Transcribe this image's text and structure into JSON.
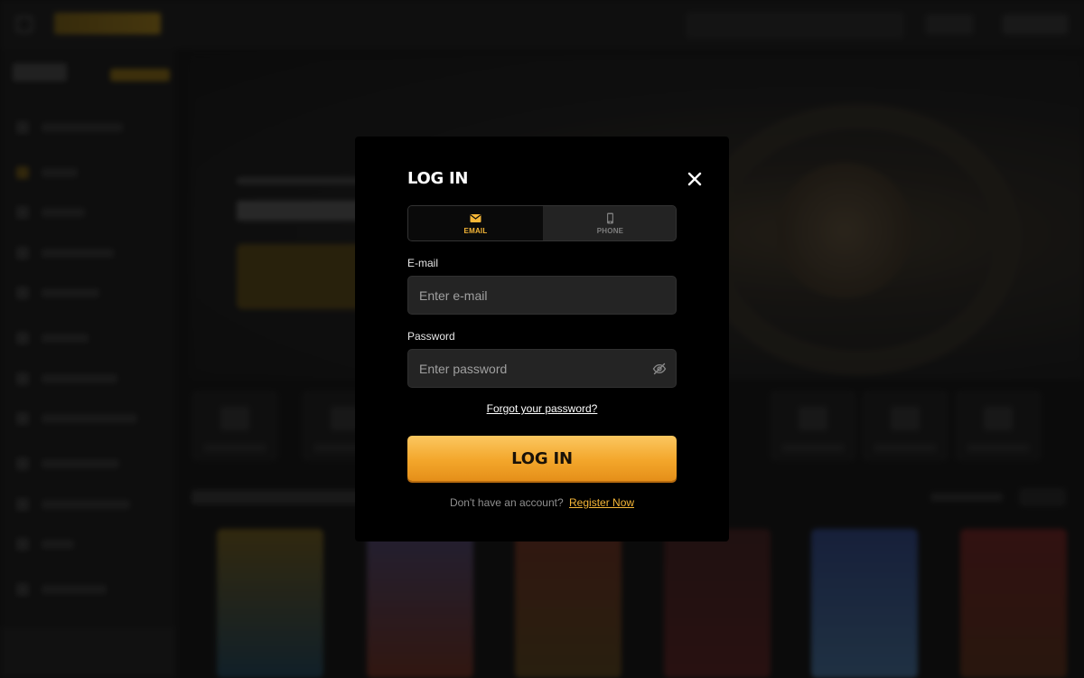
{
  "modal": {
    "title": "LOG IN",
    "close_icon": "close-icon",
    "tabs": [
      {
        "label": "EMAIL",
        "icon": "envelope-icon",
        "active": true
      },
      {
        "label": "PHONE",
        "icon": "phone-icon",
        "active": false
      }
    ],
    "email": {
      "label": "E-mail",
      "placeholder": "Enter e-mail",
      "value": ""
    },
    "password": {
      "label": "Password",
      "placeholder": "Enter password",
      "value": "",
      "toggle_icon": "eye-off-icon"
    },
    "forgot_link": "Forgot your password?",
    "submit_label": "LOG IN",
    "register_prompt": "Don't have an account?",
    "register_link": "Register Now"
  },
  "colors": {
    "accent": "#f5b637",
    "button_top": "#fbc760",
    "button_bottom": "#e58f19",
    "modal_bg": "#000000",
    "field_bg": "#242424"
  }
}
